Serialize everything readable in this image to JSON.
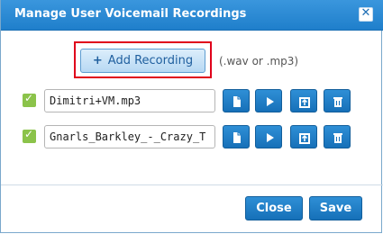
{
  "dialog": {
    "title": "Manage User Voicemail Recordings",
    "close_icon": "close-x-icon"
  },
  "add_recording": {
    "label": "Add Recording",
    "icon": "plus-icon",
    "hint": "(.wav or .mp3)"
  },
  "recordings": [
    {
      "filename": "Dimitri+VM.mp3",
      "checked": true
    },
    {
      "filename": "Gnarls_Barkley_-_Crazy_T",
      "checked": true
    }
  ],
  "row_actions": [
    "file-icon",
    "play-icon",
    "upload-icon",
    "trash-icon"
  ],
  "footer": {
    "close_label": "Close",
    "save_label": "Save"
  },
  "colors": {
    "titlebar": "#2a8ad5",
    "accent": "#1f7fcb",
    "check": "#8bc34a",
    "highlight_border": "#e0001b"
  }
}
